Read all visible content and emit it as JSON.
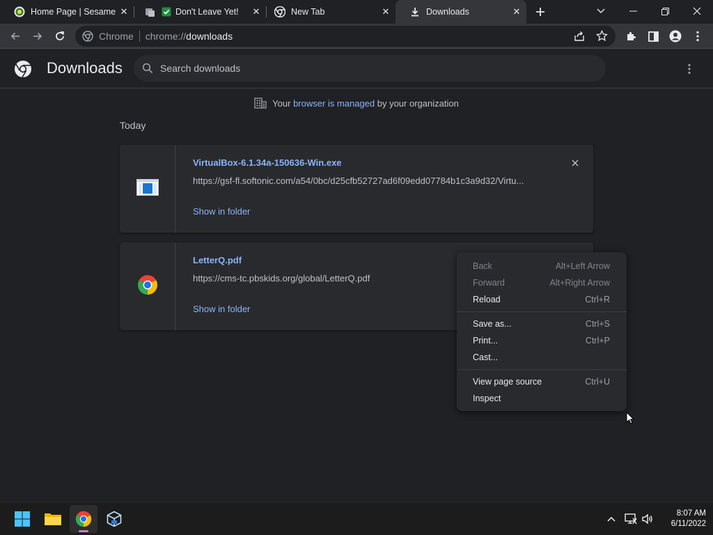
{
  "tabs": [
    {
      "title": "Home Page | Sesame St",
      "icon": "sesame-street-icon",
      "active": false
    },
    {
      "title": "Don't Leave Yet!",
      "icon": "checkbox-tab-icon",
      "active": false
    },
    {
      "title": "New Tab",
      "icon": "chrome-icon",
      "active": false
    },
    {
      "title": "Downloads",
      "icon": "download-icon",
      "active": true
    }
  ],
  "toolbar": {
    "site_label": "Chrome",
    "url_prefix": "chrome://",
    "url_path": "downloads"
  },
  "header": {
    "title": "Downloads",
    "search_placeholder": "Search downloads"
  },
  "managed": {
    "prefix": "Your ",
    "link": "browser is managed",
    "suffix": " by your organization"
  },
  "section_label": "Today",
  "downloads": [
    {
      "name": "VirtualBox-6.1.34a-150636-Win.exe",
      "url": "https://gsf-fl.softonic.com/a54/0bc/d25cfb52727ad6f09edd07784b1c3a9d32/Virtu...",
      "action": "Show in folder",
      "icon": "exe-file-icon"
    },
    {
      "name": "LetterQ.pdf",
      "url": "https://cms-tc.pbskids.org/global/LetterQ.pdf",
      "action": "Show in folder",
      "icon": "chrome-icon"
    }
  ],
  "context_menu": {
    "groups": [
      [
        {
          "label": "Back",
          "shortcut": "Alt+Left Arrow",
          "disabled": true
        },
        {
          "label": "Forward",
          "shortcut": "Alt+Right Arrow",
          "disabled": true
        },
        {
          "label": "Reload",
          "shortcut": "Ctrl+R",
          "disabled": false
        }
      ],
      [
        {
          "label": "Save as...",
          "shortcut": "Ctrl+S",
          "disabled": false
        },
        {
          "label": "Print...",
          "shortcut": "Ctrl+P",
          "disabled": false
        },
        {
          "label": "Cast...",
          "shortcut": "",
          "disabled": false
        }
      ],
      [
        {
          "label": "View page source",
          "shortcut": "Ctrl+U",
          "disabled": false
        },
        {
          "label": "Inspect",
          "shortcut": "",
          "disabled": false
        }
      ]
    ]
  },
  "taskbar": {
    "apps": [
      "windows-start-icon",
      "file-explorer-icon",
      "chrome-icon",
      "virtualbox-icon"
    ],
    "time": "8:07 AM",
    "date": "6/11/2022"
  },
  "colors": {
    "background": "#202124",
    "link": "#8ab4f8",
    "surface": "#292a2d"
  }
}
